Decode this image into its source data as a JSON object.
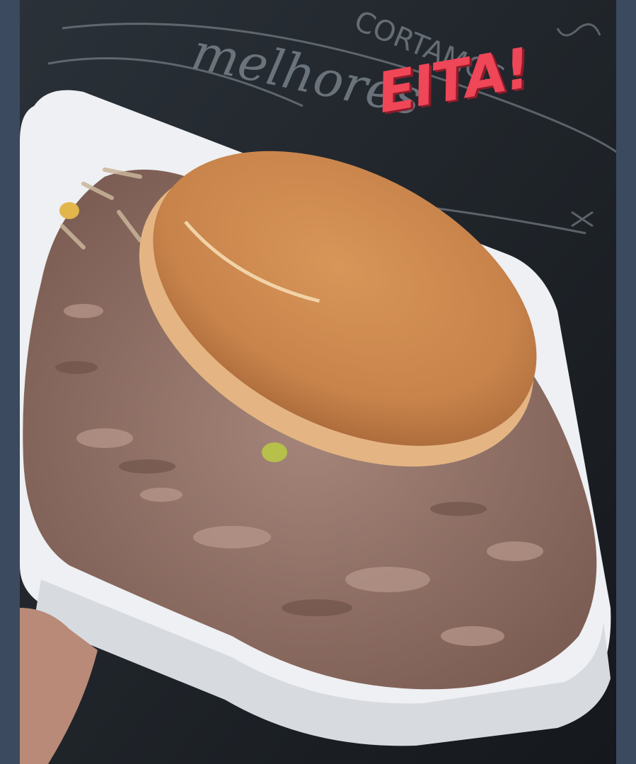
{
  "story": {
    "sticker_text": "EITA!",
    "colors": {
      "side_bars": "#3b4a5e",
      "chalkboard": "#1d2126",
      "chalk": "#9aa3ad",
      "tray": "#eef0f3",
      "bun": "#cf8a4a",
      "stroganoff": "#9c7a6e",
      "sticker": "#ef4658"
    },
    "chalk_words": [
      "CORTAMOS",
      "melhores"
    ]
  }
}
